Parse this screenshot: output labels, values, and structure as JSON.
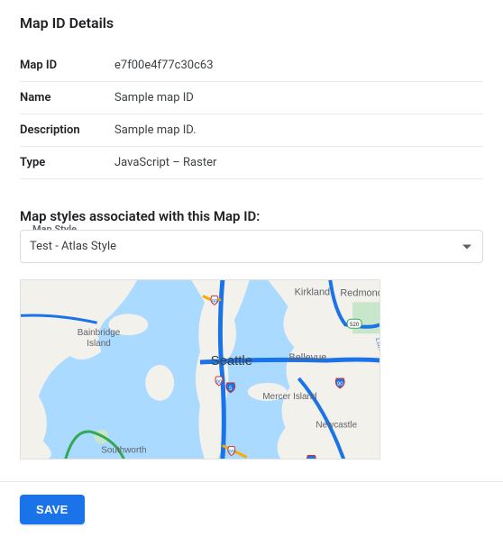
{
  "header": {
    "title": "Map ID Details"
  },
  "details": {
    "rows": [
      {
        "label": "Map ID",
        "value": "e7f00e4f77c30c63"
      },
      {
        "label": "Name",
        "value": "Sample map ID"
      },
      {
        "label": "Description",
        "value": "Sample map ID."
      },
      {
        "label": "Type",
        "value": "JavaScript – Raster"
      }
    ]
  },
  "styles_section": {
    "heading": "Map styles associated with this Map ID:",
    "select_label": "Map Style",
    "selected_value": "Test - Atlas Style"
  },
  "footer": {
    "save_label": "SAVE"
  }
}
